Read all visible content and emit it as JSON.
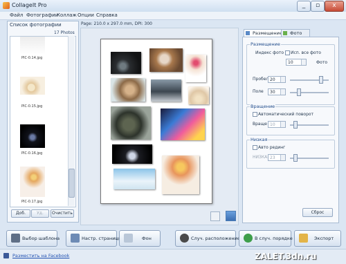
{
  "window": {
    "title": "CollageIt Pro",
    "controls": [
      "_",
      "▫",
      "x"
    ]
  },
  "menu": [
    "Файл",
    "Фотографии",
    "Коллаж",
    "Опции",
    "Справка"
  ],
  "left_panel": {
    "title": "Список фотографии",
    "count": "17 Photos",
    "thumbs": [
      {
        "label": "PIC-0.14.jpg"
      },
      {
        "label": "PIC-0.15.jpg"
      },
      {
        "label": "PIC-0.16.jpg"
      },
      {
        "label": "PIC-0.17.jpg"
      }
    ],
    "buttons": {
      "add": "Доб.",
      "remove": "Уд.",
      "clear": "Очистить"
    }
  },
  "page_info": "Page: 210.0 x 297.0 mm, DPI: 300",
  "view_icons": [
    "single-view-icon",
    "grid-view-icon"
  ],
  "right_panel": {
    "tabs": [
      "Размещение",
      "Фото"
    ],
    "layout": {
      "title": "Размещение",
      "index_label": "Индекс фото",
      "all_photos_label": "Исп. все фото",
      "photo_count": "10",
      "photo_unit": "Фото",
      "spacing_label": "Пробел",
      "spacing_value": "20",
      "margin_label": "Поле",
      "margin_value": "30",
      "spacing_level": 0.8,
      "margin_level": 0.2
    },
    "rotation": {
      "title": "Вращение",
      "auto_label": "Автоматический поворот",
      "rotate_label": "Враще",
      "rotate_value": "10",
      "rotate_level": 0.1
    },
    "shadow": {
      "title": "Низкая",
      "auto_label": "Авто рединг",
      "level_label": "НИЗКАЯ",
      "level_value": "23",
      "shadow_level": 0.1
    },
    "reset": "Сброс"
  },
  "bottom_buttons": [
    {
      "label": "Выбор шаблона",
      "icon": "template-icon",
      "color": "#5f6f86"
    },
    {
      "label": "Настр. страницы",
      "icon": "page-setup-icon",
      "color": "#6d8bb5"
    },
    {
      "label": "Фон",
      "icon": "background-icon",
      "color": "#b9c7d8"
    },
    {
      "label": "Случ. расположение",
      "icon": "random-layout-icon",
      "color": "#4a4a4a"
    },
    {
      "label": "В случ. порядке",
      "icon": "shuffle-icon",
      "color": "#3e9e4a"
    },
    {
      "label": "Экспорт",
      "icon": "export-icon",
      "color": "#e3b448"
    }
  ],
  "status": {
    "facebook_link": "Разместить на Facebook",
    "watermark": "ZALET.3dn.ru"
  }
}
